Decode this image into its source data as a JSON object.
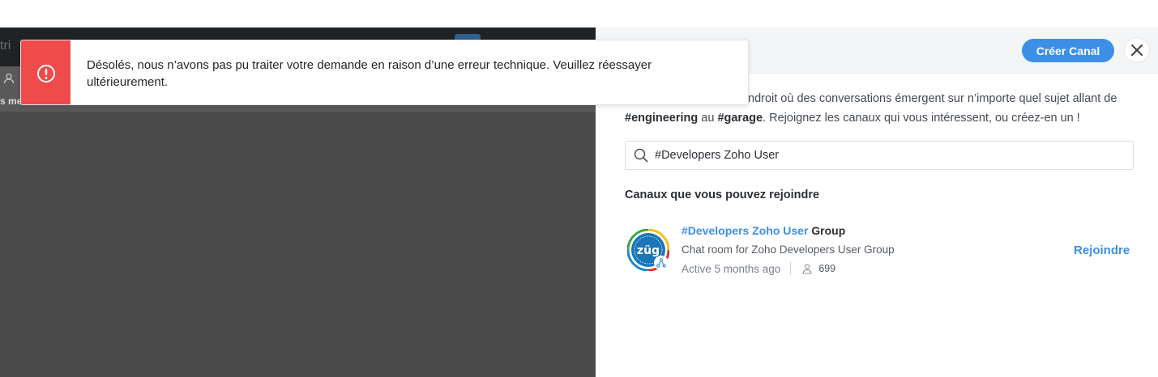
{
  "left_pane": {
    "top_strip_text": "tri",
    "mid_strip_text": "s me"
  },
  "toast": {
    "icon": "alert-circle-icon",
    "message": "Désolés, nous n’avons pas pu traiter votre demande en raison d’une erreur technique. Veuillez réessayer ultérieurement.",
    "accent_color": "#f04b4b"
  },
  "header": {
    "create_button_label": "Créer Canal",
    "close_icon": "close-icon"
  },
  "intro": {
    "line1_visible": "ndroit où des conversations émergent sur n’importe quel sujet allant de",
    "tag1": "#engineering",
    "mid_text": " au ",
    "tag2": "#garage",
    "tail_text": ". Rejoignez les canaux qui vous intéressent, ou créez-en un !"
  },
  "search": {
    "value": "#Developers Zoho User",
    "icon": "search-icon"
  },
  "section": {
    "title": "Canaux que vous pouvez rejoindre"
  },
  "channels": [
    {
      "name_highlight": "#Developers Zoho User",
      "name_rest": " Group",
      "description": "Chat room for Zoho Developers User Group",
      "activity": "Active 5 months ago",
      "members": "699",
      "join_label": "Rejoindre",
      "avatar_text": "züg"
    }
  ],
  "colors": {
    "accent": "#3d8fe6",
    "error": "#f04b4b"
  }
}
